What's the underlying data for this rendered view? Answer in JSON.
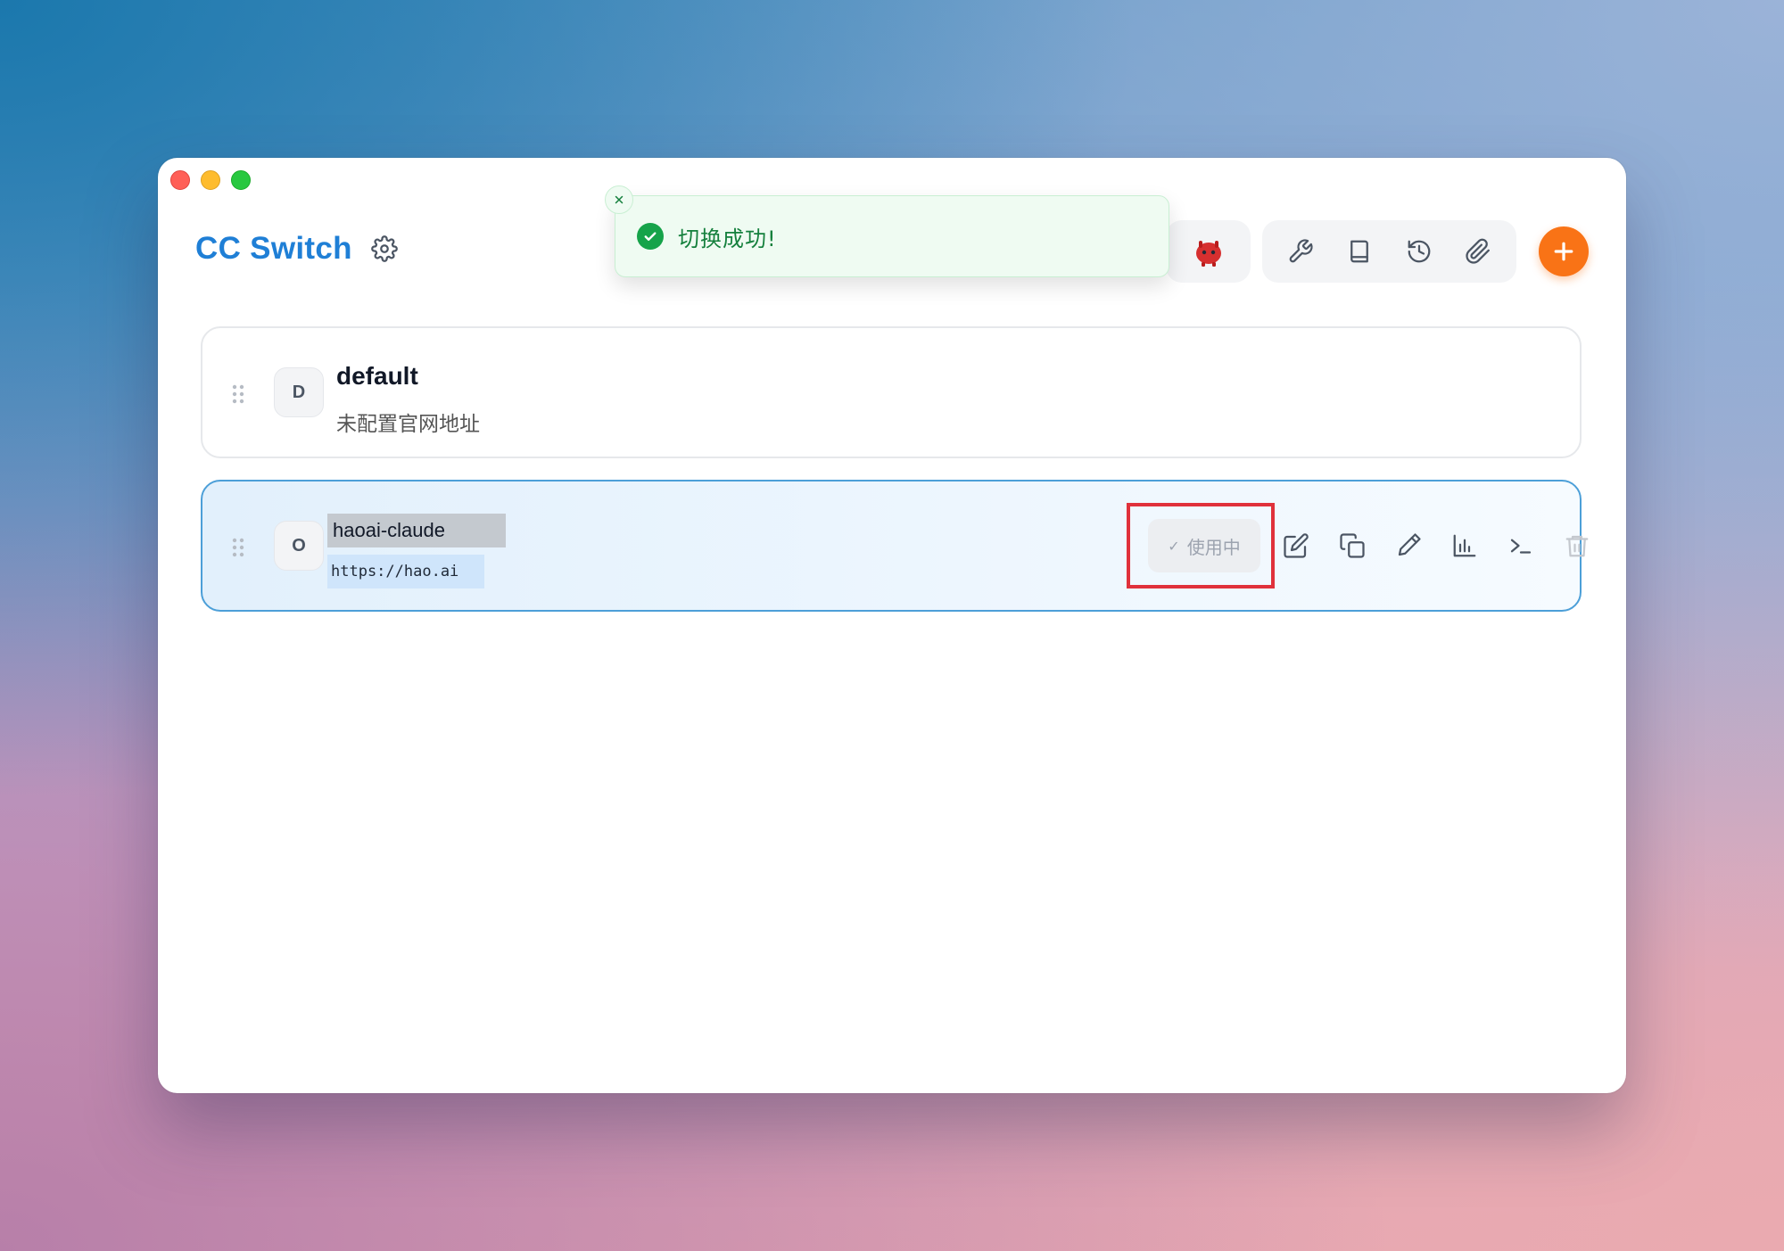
{
  "app": {
    "title": "CC Switch"
  },
  "toast": {
    "message": "切换成功!"
  },
  "providers": [
    {
      "initial": "D",
      "name": "default",
      "subtitle": "未配置官网地址"
    },
    {
      "initial": "O",
      "name": "haoai-claude",
      "url": "https://hao.ai",
      "status_label": "使用中",
      "active": true
    }
  ],
  "toolbar": {
    "icons": [
      "mascot-icon",
      "wrench-icon",
      "book-icon",
      "history-icon",
      "paperclip-icon",
      "plus-icon"
    ]
  },
  "card_actions": [
    "edit-icon",
    "copy-icon",
    "brush-icon",
    "bar-chart-icon",
    "terminal-icon",
    "trash-icon"
  ],
  "colors": {
    "brand": "#1f7fd6",
    "accent": "#f97316",
    "success": "#16a34a",
    "highlight": "#e0313b"
  }
}
